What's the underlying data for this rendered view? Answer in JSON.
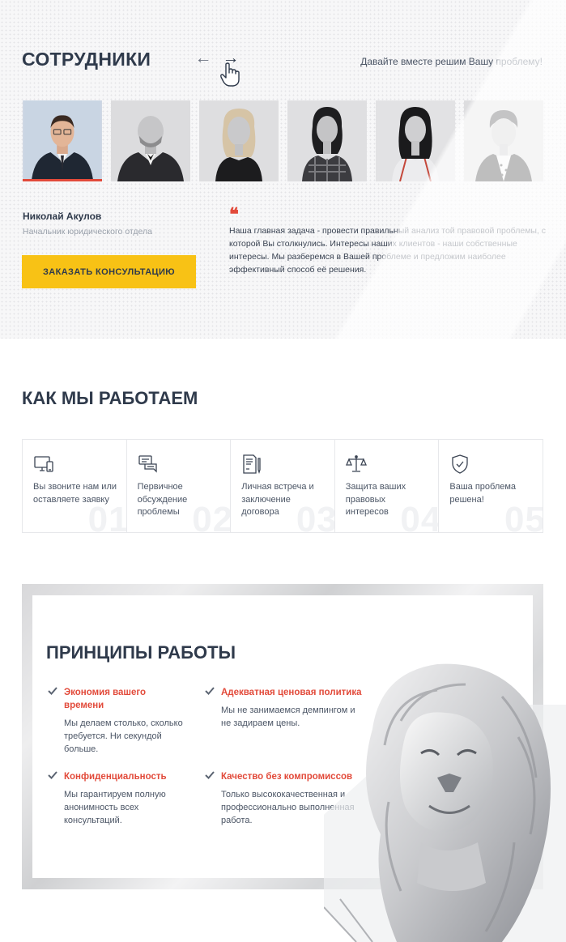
{
  "team": {
    "title": "СОТРУДНИКИ",
    "tagline": "Давайте вместе решим Вашу проблему!",
    "nav": {
      "prev": "←",
      "next": "→"
    },
    "members_photos": [
      {
        "active": true
      },
      {
        "active": false
      },
      {
        "active": false
      },
      {
        "active": false
      },
      {
        "active": false
      },
      {
        "active": false
      }
    ],
    "selected": {
      "name": "Николай Акулов",
      "role": "Начальник юридического отдела"
    },
    "consult_button": "ЗАКАЗАТЬ КОНСУЛЬТАЦИЮ",
    "quote_mark": "❝",
    "quote": "Наша главная задача - провести правильный анализ той правовой проблемы, с которой Вы столкнулись. Интересы наших клиентов - наши собственные интересы. Мы разберемся в Вашей проблеме и предложим наиболее эффективный способ её решения."
  },
  "how": {
    "title": "КАК МЫ РАБОТАЕМ",
    "steps": [
      {
        "icon": "computer-phone-icon",
        "text": "Вы звоните нам или оставляете заявку",
        "num": "01"
      },
      {
        "icon": "chat-bubbles-icon",
        "text": "Первичное обсуждение проблемы",
        "num": "02"
      },
      {
        "icon": "contract-pen-icon",
        "text": "Личная встреча и заключение договора",
        "num": "03"
      },
      {
        "icon": "scales-icon",
        "text": "Защита ваших правовых интересов",
        "num": "04"
      },
      {
        "icon": "shield-check-icon",
        "text": "Ваша проблема решена!",
        "num": "05"
      }
    ]
  },
  "principles": {
    "title": "ПРИНЦИПЫ РАБОТЫ",
    "items": [
      {
        "head": "Экономия вашего времени",
        "body": "Мы делаем столько, сколько требуется. Ни секундой больше."
      },
      {
        "head": "Адекватная ценовая политика",
        "body": "Мы не занимаемся демпингом и не задираем цены."
      },
      {
        "head": "Конфиденциальность",
        "body": "Мы гарантируем полную анонимность всех консультаций."
      },
      {
        "head": "Качество без компромиссов",
        "body": "Только высококачественная и профессионально выполненная работа."
      }
    ]
  },
  "colors": {
    "accent_red": "#e24a3a",
    "button_yellow": "#f8c215",
    "heading": "#2f3a4b"
  }
}
